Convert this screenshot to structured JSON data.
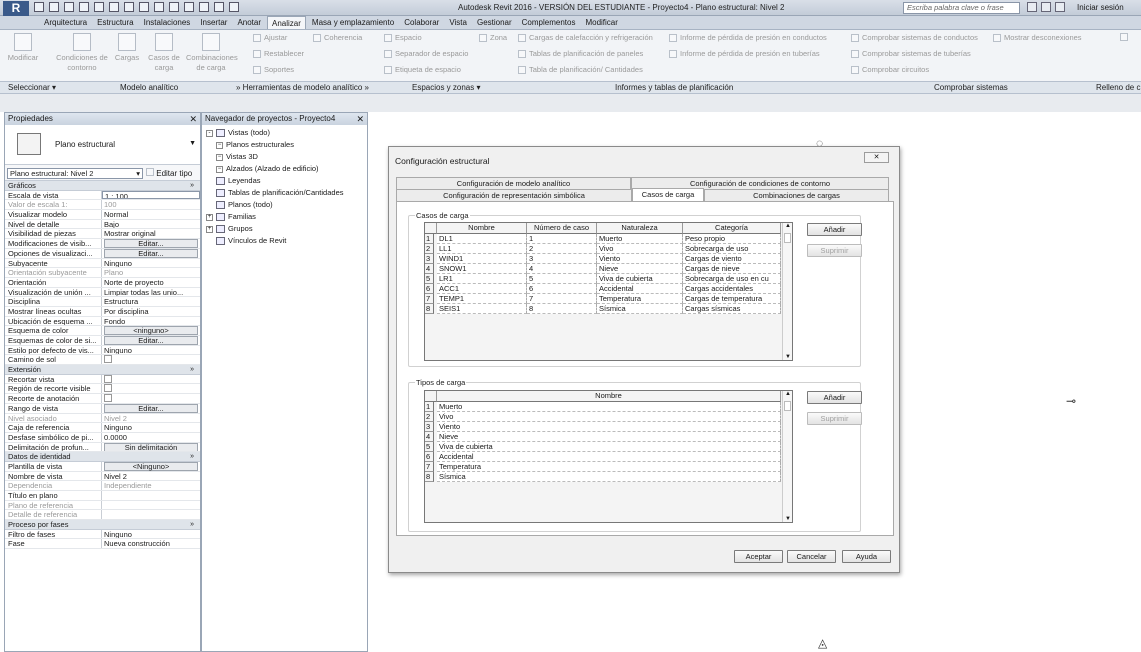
{
  "titlebar": {
    "app_title": "Autodesk Revit 2016 - VERSIÓN DEL ESTUDIANTE -   Proyecto4 - Plano estructural: Nivel 2",
    "search_placeholder": "Escriba palabra clave o frase",
    "sign_in": "Iniciar sesión",
    "logo_letter": "R"
  },
  "ribbon_tabs": [
    "Arquitectura",
    "Estructura",
    "Instalaciones",
    "Insertar",
    "Anotar",
    "Analizar",
    "Masa y emplazamiento",
    "Colaborar",
    "Vista",
    "Gestionar",
    "Complementos",
    "Modificar"
  ],
  "active_tab": "Analizar",
  "ribbon": {
    "modify": "Modificar",
    "boundary_conditions": "Condiciones de contorno",
    "loads": "Cargas",
    "load_cases": "Casos de carga",
    "load_combinations": "Combinaciones de carga",
    "adjust": "Ajustar",
    "reset": "Restablecer",
    "supports": "Soportes",
    "consistency": "Coherencia",
    "space": "Espacio",
    "space_separator": "Separador de espacio",
    "space_tag": "Etiqueta de espacio",
    "zone": "Zona",
    "heating_cooling": "Cargas de calefacción y refrigeración",
    "panel_schedules": "Tablas de planificación de paneles",
    "schedules_quantities": "Tabla de planificación/ Cantidades",
    "duct_pressure_loss": "Informe de pérdida de presión en conductos",
    "pipe_pressure_loss": "Informe de pérdida de presión en tuberías",
    "check_ducts": "Comprobar sistemas de conductos",
    "check_pipes": "Comprobar sistemas de tuberías",
    "check_circuits": "Comprobar circuitos",
    "show_disconnects": "Mostrar desconexiones"
  },
  "panels": {
    "select": "Seleccionar",
    "analytical_model": "Modelo analítico",
    "analytical_tools": "Herramientas de modelo analítico",
    "spaces_zones": "Espacios y zonas",
    "reports_schedules": "Informes y tablas de planificación",
    "check_systems": "Comprobar sistemas",
    "fill": "Relleno de c"
  },
  "properties": {
    "title": "Propiedades",
    "type_name": "Plano estructural",
    "instance_selector": "Plano estructural: Nivel 2",
    "edit_type": "Editar tipo",
    "sections": [
      {
        "name": "Gráficos",
        "rows": [
          {
            "k": "Escala de vista",
            "v": "1 : 100",
            "kind": "input"
          },
          {
            "k": "Valor de escala    1:",
            "v": "100",
            "kind": "dis"
          },
          {
            "k": "Visualizar modelo",
            "v": "Normal"
          },
          {
            "k": "Nivel de detalle",
            "v": "Bajo"
          },
          {
            "k": "Visibilidad de piezas",
            "v": "Mostrar original"
          },
          {
            "k": "Modificaciones de visib...",
            "v": "Editar...",
            "kind": "btn"
          },
          {
            "k": "Opciones de visualizaci...",
            "v": "Editar...",
            "kind": "btn"
          },
          {
            "k": "Subyacente",
            "v": "Ninguno"
          },
          {
            "k": "Orientación subyacente",
            "v": "Plano",
            "kind": "dis"
          },
          {
            "k": "Orientación",
            "v": "Norte de proyecto"
          },
          {
            "k": "Visualización de unión ...",
            "v": "Limpiar todas las unio..."
          },
          {
            "k": "Disciplina",
            "v": "Estructura"
          },
          {
            "k": "Mostrar líneas ocultas",
            "v": "Por disciplina"
          },
          {
            "k": "Ubicación de esquema ...",
            "v": "Fondo"
          },
          {
            "k": "Esquema de color",
            "v": "<ninguno>",
            "kind": "btn"
          },
          {
            "k": "Esquemas de color de si...",
            "v": "Editar...",
            "kind": "btn"
          },
          {
            "k": "Estilo por defecto de vis...",
            "v": "Ninguno"
          },
          {
            "k": "Camino de sol",
            "v": "",
            "kind": "chk"
          }
        ]
      },
      {
        "name": "Extensión",
        "rows": [
          {
            "k": "Recortar vista",
            "v": "",
            "kind": "chk"
          },
          {
            "k": "Región de recorte visible",
            "v": "",
            "kind": "chk"
          },
          {
            "k": "Recorte de anotación",
            "v": "",
            "kind": "chk"
          },
          {
            "k": "Rango de vista",
            "v": "Editar...",
            "kind": "btn"
          },
          {
            "k": "Nivel asociado",
            "v": "Nivel 2",
            "kind": "dis"
          },
          {
            "k": "Caja de referencia",
            "v": "Ninguno"
          },
          {
            "k": "Desfase simbólico de pi...",
            "v": "0.0000"
          },
          {
            "k": "Delimitación de profun...",
            "v": "Sin delimitación",
            "kind": "btn"
          }
        ]
      },
      {
        "name": "Datos de identidad",
        "rows": [
          {
            "k": "Plantilla de vista",
            "v": "<Ninguno>",
            "kind": "btn"
          },
          {
            "k": "Nombre de vista",
            "v": "Nivel 2"
          },
          {
            "k": "Dependencia",
            "v": "Independiente",
            "kind": "dis"
          },
          {
            "k": "Título en plano",
            "v": ""
          },
          {
            "k": "Plano de referencia",
            "v": "",
            "kind": "dis"
          },
          {
            "k": "Detalle de referencia",
            "v": "",
            "kind": "dis"
          }
        ]
      },
      {
        "name": "Proceso por fases",
        "rows": [
          {
            "k": "Filtro de fases",
            "v": "Ninguno"
          },
          {
            "k": "Fase",
            "v": "Nueva construcción"
          }
        ]
      }
    ]
  },
  "browser": {
    "title": "Navegador de proyectos - Proyecto4",
    "nodes": [
      {
        "label": "Vistas (todo)",
        "level": 0,
        "exp": "-"
      },
      {
        "label": "Planos estructurales",
        "level": 1
      },
      {
        "label": "Vistas 3D",
        "level": 1
      },
      {
        "label": "Alzados (Alzado de edificio)",
        "level": 1
      },
      {
        "label": "Leyendas",
        "level": 0
      },
      {
        "label": "Tablas de planificación/Cantidades",
        "level": 0
      },
      {
        "label": "Planos (todo)",
        "level": 0
      },
      {
        "label": "Familias",
        "level": 0,
        "exp": "+"
      },
      {
        "label": "Grupos",
        "level": 0,
        "exp": "+"
      },
      {
        "label": "Vínculos de Revit",
        "level": 0
      }
    ]
  },
  "dialog": {
    "title": "Configuración estructural",
    "tabs_back": [
      "Configuración de modelo analítico",
      "Configuración de condiciones de contorno"
    ],
    "tabs_front": [
      "Configuración de representación simbólica",
      "Casos de carga",
      "Combinaciones de cargas"
    ],
    "active_tab": "Casos de carga",
    "load_cases": {
      "label": "Casos de carga",
      "headers": [
        "Nombre",
        "Número de caso",
        "Naturaleza",
        "Categoría"
      ],
      "rows": [
        [
          "DL1",
          "1",
          "Muerto",
          "Peso propio"
        ],
        [
          "LL1",
          "2",
          "Vivo",
          "Sobrecarga de uso"
        ],
        [
          "WIND1",
          "3",
          "Viento",
          "Cargas de viento"
        ],
        [
          "SNOW1",
          "4",
          "Nieve",
          "Cargas de nieve"
        ],
        [
          "LR1",
          "5",
          "Viva de cubierta",
          "Sobrecarga de uso en cu"
        ],
        [
          "ACC1",
          "6",
          "Accidental",
          "Cargas accidentales"
        ],
        [
          "TEMP1",
          "7",
          "Temperatura",
          "Cargas de temperatura"
        ],
        [
          "SEIS1",
          "8",
          "Sísmica",
          "Cargas sísmicas"
        ]
      ],
      "add": "Añadir",
      "remove": "Suprimir"
    },
    "load_types": {
      "label": "Tipos de carga",
      "header": "Nombre",
      "rows": [
        "Muerto",
        "Vivo",
        "Viento",
        "Nieve",
        "Viva de cubierta",
        "Accidental",
        "Temperatura",
        "Sísmica"
      ],
      "add": "Añadir",
      "remove": "Suprimir"
    },
    "ok": "Aceptar",
    "cancel": "Cancelar",
    "help": "Ayuda"
  }
}
